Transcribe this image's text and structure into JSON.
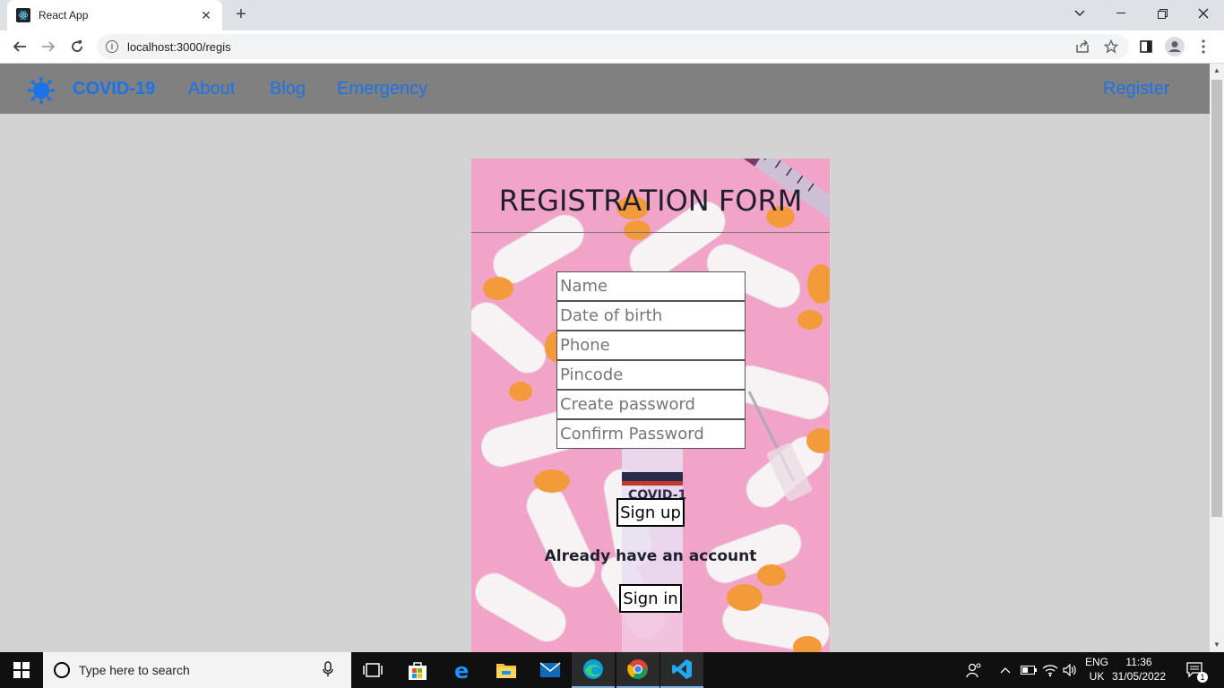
{
  "browser": {
    "tab_title": "React App",
    "url": "localhost:3000/regis"
  },
  "navbar": {
    "brand": "COVID-19",
    "links": [
      "About",
      "Blog",
      "Emergency"
    ],
    "register": "Register"
  },
  "form": {
    "title": "REGISTRATION FORM",
    "fields": [
      {
        "placeholder": "Name"
      },
      {
        "placeholder": "Date of birth"
      },
      {
        "placeholder": "Phone"
      },
      {
        "placeholder": "Pincode"
      },
      {
        "placeholder": "Create password"
      },
      {
        "placeholder": "Confirm Password"
      }
    ],
    "signup_label": "Sign up",
    "already_text": "Already have an account",
    "signin_label": "Sign in"
  },
  "taskbar": {
    "search_placeholder": "Type here to search",
    "lang_line1": "ENG",
    "lang_line2": "UK",
    "time": "11:36",
    "date": "31/05/2022",
    "notification_count": "1"
  },
  "colors": {
    "link_blue": "#1a73e8",
    "navbar_gray": "#808080",
    "page_bg": "#d3d3d3",
    "card_pink": "#f0a6c6"
  }
}
